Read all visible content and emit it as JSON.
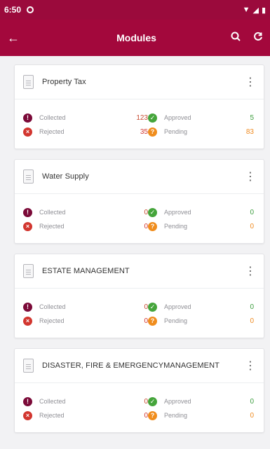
{
  "status": {
    "time": "6:50"
  },
  "app": {
    "title": "Modules"
  },
  "cards": [
    {
      "title": "Property Tax",
      "stats": {
        "collected_label": "Collected",
        "collected_value": "123",
        "approved_label": "Approved",
        "approved_value": "5",
        "rejected_label": "Rejected",
        "rejected_value": "35",
        "pending_label": "Pending",
        "pending_value": "83"
      }
    },
    {
      "title": "Water Supply",
      "stats": {
        "collected_label": "Collected",
        "collected_value": "0",
        "approved_label": "Approved",
        "approved_value": "0",
        "rejected_label": "Rejected",
        "rejected_value": "0",
        "pending_label": "Pending",
        "pending_value": "0"
      }
    },
    {
      "title": "ESTATE MANAGEMENT",
      "stats": {
        "collected_label": "Collected",
        "collected_value": "0",
        "approved_label": "Approved",
        "approved_value": "0",
        "rejected_label": "Rejected",
        "rejected_value": "0",
        "pending_label": "Pending",
        "pending_value": "0"
      }
    },
    {
      "title": "DISASTER, FIRE & EMERGENCYMANAGEMENT",
      "stats": {
        "collected_label": "Collected",
        "collected_value": "0",
        "approved_label": "Approved",
        "approved_value": "0",
        "rejected_label": "Rejected",
        "rejected_value": "0",
        "pending_label": "Pending",
        "pending_value": "0"
      }
    }
  ],
  "colors": {
    "primary": "#a3083c",
    "collected": "#7b0a38",
    "rejected": "#d2362f",
    "approved": "#45a53b",
    "pending": "#f08d1d",
    "green_value": "#3a9c3c",
    "orange_value": "#ef8a1f"
  },
  "icons": {
    "back": "arrow-left-icon",
    "search": "search-icon",
    "refresh": "refresh-icon",
    "doc": "document-icon",
    "menu": "kebab-menu-icon"
  }
}
